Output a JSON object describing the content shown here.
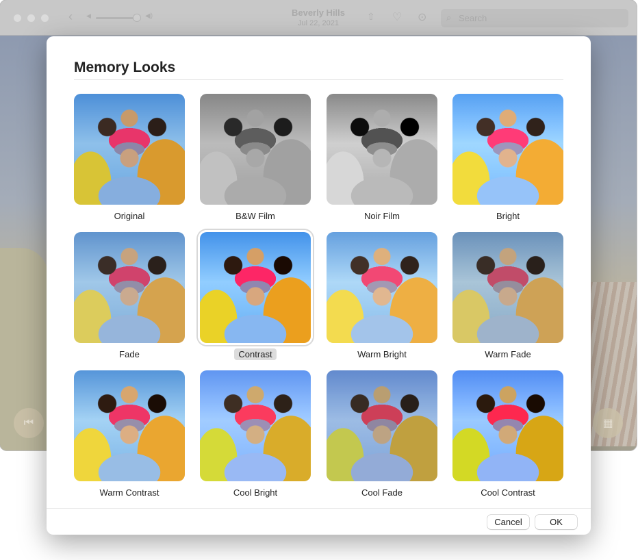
{
  "window": {
    "title": "Beverly Hills",
    "date": "Jul 22, 2021",
    "search_placeholder": "Search"
  },
  "dialog": {
    "title": "Memory Looks",
    "selected": "Contrast",
    "looks": [
      {
        "label": "Original",
        "filter": "none"
      },
      {
        "label": "B&W Film",
        "filter": "bw"
      },
      {
        "label": "Noir Film",
        "filter": "noir"
      },
      {
        "label": "Bright",
        "filter": "bright"
      },
      {
        "label": "Fade",
        "filter": "fade"
      },
      {
        "label": "Contrast",
        "filter": "contrast"
      },
      {
        "label": "Warm Bright",
        "filter": "wb"
      },
      {
        "label": "Warm Fade",
        "filter": "wf"
      },
      {
        "label": "Warm Contrast",
        "filter": "wc"
      },
      {
        "label": "Cool Bright",
        "filter": "cb"
      },
      {
        "label": "Cool Fade",
        "filter": "cf"
      },
      {
        "label": "Cool Contrast",
        "filter": "cc"
      }
    ],
    "cancel_label": "Cancel",
    "ok_label": "OK"
  }
}
